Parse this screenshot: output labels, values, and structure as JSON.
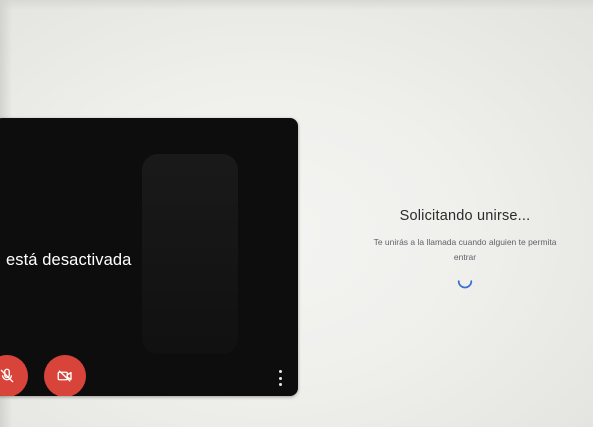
{
  "preview": {
    "status_text": "está desactivada",
    "mic_button_icon": "mic-off-icon",
    "camera_button_icon": "videocam-off-icon",
    "more_icon": "more-vert-icon"
  },
  "join": {
    "title": "Solicitando unirse...",
    "subtitle": "Te unirás a la llamada cuando alguien te permita entrar",
    "spinner_icon": "loading-spinner-icon"
  },
  "colors": {
    "control_red": "#d9443a",
    "preview_bg": "#0d0d0d",
    "spinner_blue": "#3c6fd1"
  }
}
